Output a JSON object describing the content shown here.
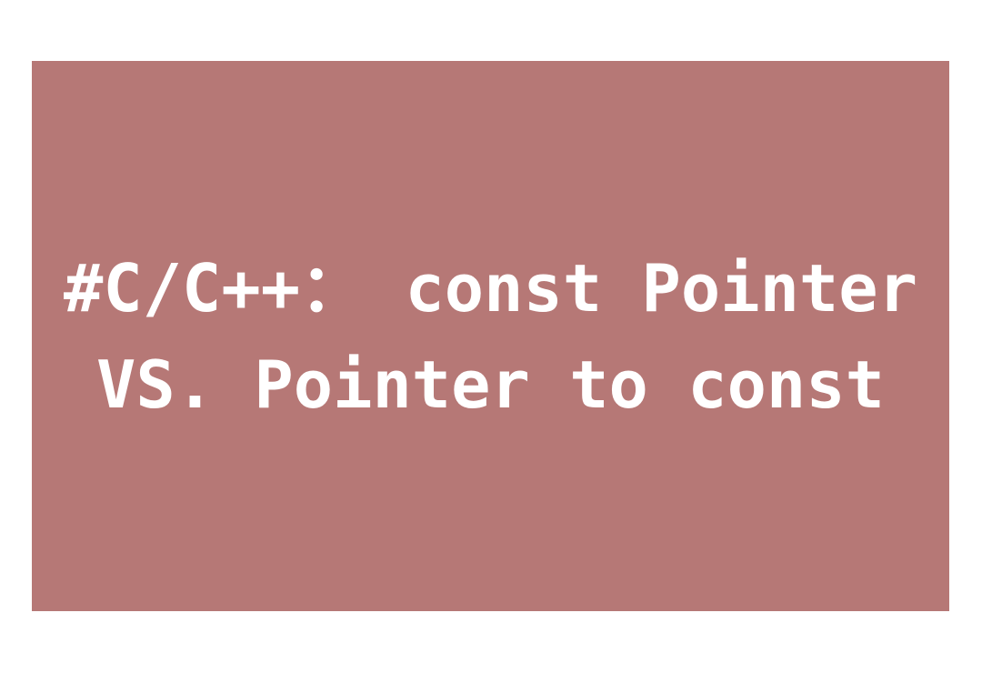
{
  "colors": {
    "page_background": "#ffffff",
    "cover_background": "#b67876",
    "title_text": "#ffffff"
  },
  "cover": {
    "title_lines": [
      "#C/C++： const Pointer",
      "VS. Pointer to const"
    ]
  }
}
